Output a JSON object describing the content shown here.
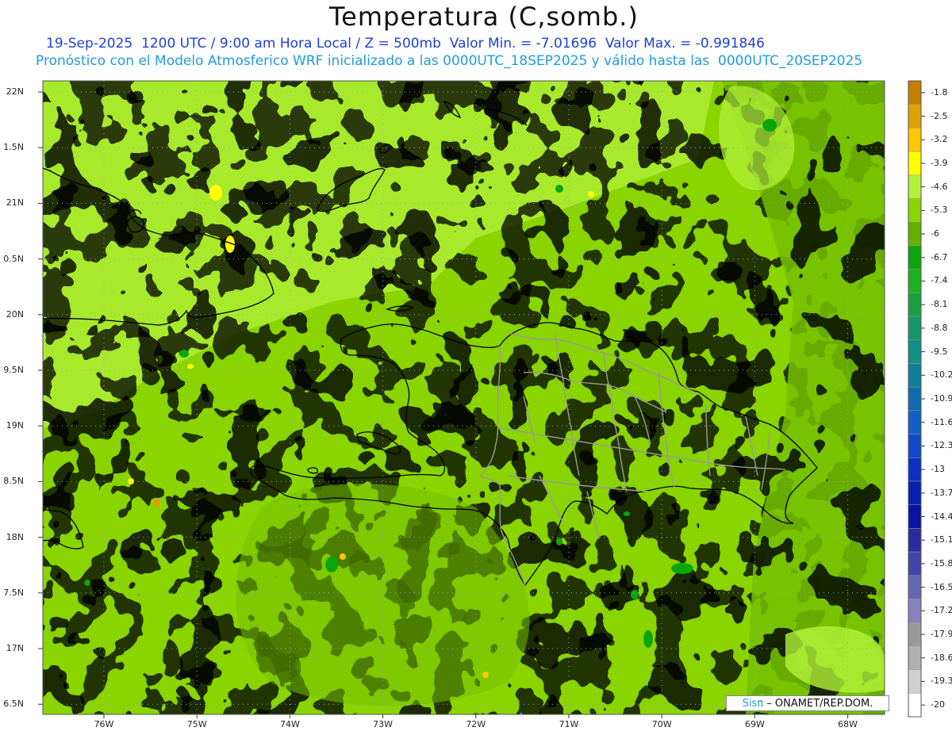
{
  "title": "Temperatura (C,somb.)",
  "subtitle_line1": "19-Sep-2025  1200 UTC / 9:00 am Hora Local / Z = 500mb  Valor Min. = -7.01696  Valor Max. = -0.991846",
  "subtitle_line2": "Pronóstico con el Modelo Atmosferico WRF inicializado a las 0000UTC_18SEP2025 y válido hasta las  0000UTC_20SEP2025",
  "lat_labels": [
    "22N",
    "1.5N",
    "21N",
    "0.5N",
    "20N",
    "9.5N",
    "19N",
    "8.5N",
    "18N",
    "7.5N",
    "17N",
    "6.5N"
  ],
  "lon_labels": [
    "76W",
    "75W",
    "74W",
    "73W",
    "72W",
    "71W",
    "70W",
    "69W",
    "68W"
  ],
  "colorbar": {
    "labels": [
      "-1.8",
      "-2.5",
      "-3.2",
      "-3.9",
      "-4.6",
      "-5.3",
      "-6",
      "-6.7",
      "-7.4",
      "-8.1",
      "-8.8",
      "-9.5",
      "-10.2",
      "-10.9",
      "-11.6",
      "-12.3",
      "-13",
      "-13.7",
      "-14.4",
      "-15.1",
      "-15.8",
      "-16.5",
      "-17.2",
      "-17.9",
      "-18.6",
      "-19.3",
      "-20"
    ],
    "colors": [
      "#c77f00",
      "#e0a200",
      "#ffc800",
      "#ffff00",
      "#b2f23a",
      "#8ad400",
      "#66b000",
      "#0aa60a",
      "#20b020",
      "#1aa040",
      "#17956b",
      "#139085",
      "#0f7e9a",
      "#0f6bae",
      "#1060c2",
      "#0f4ac8",
      "#0a30c0",
      "#0a1eb0",
      "#0b11a0",
      "#2a2a9e",
      "#4444a8",
      "#6666b2",
      "#8a82bc",
      "#9a9a9a",
      "#b0b0b0",
      "#d0d0d0",
      "#ffffff"
    ]
  },
  "credit": {
    "prefix": "Sisπ",
    "text": " – ONAMET/REP.DOM."
  }
}
